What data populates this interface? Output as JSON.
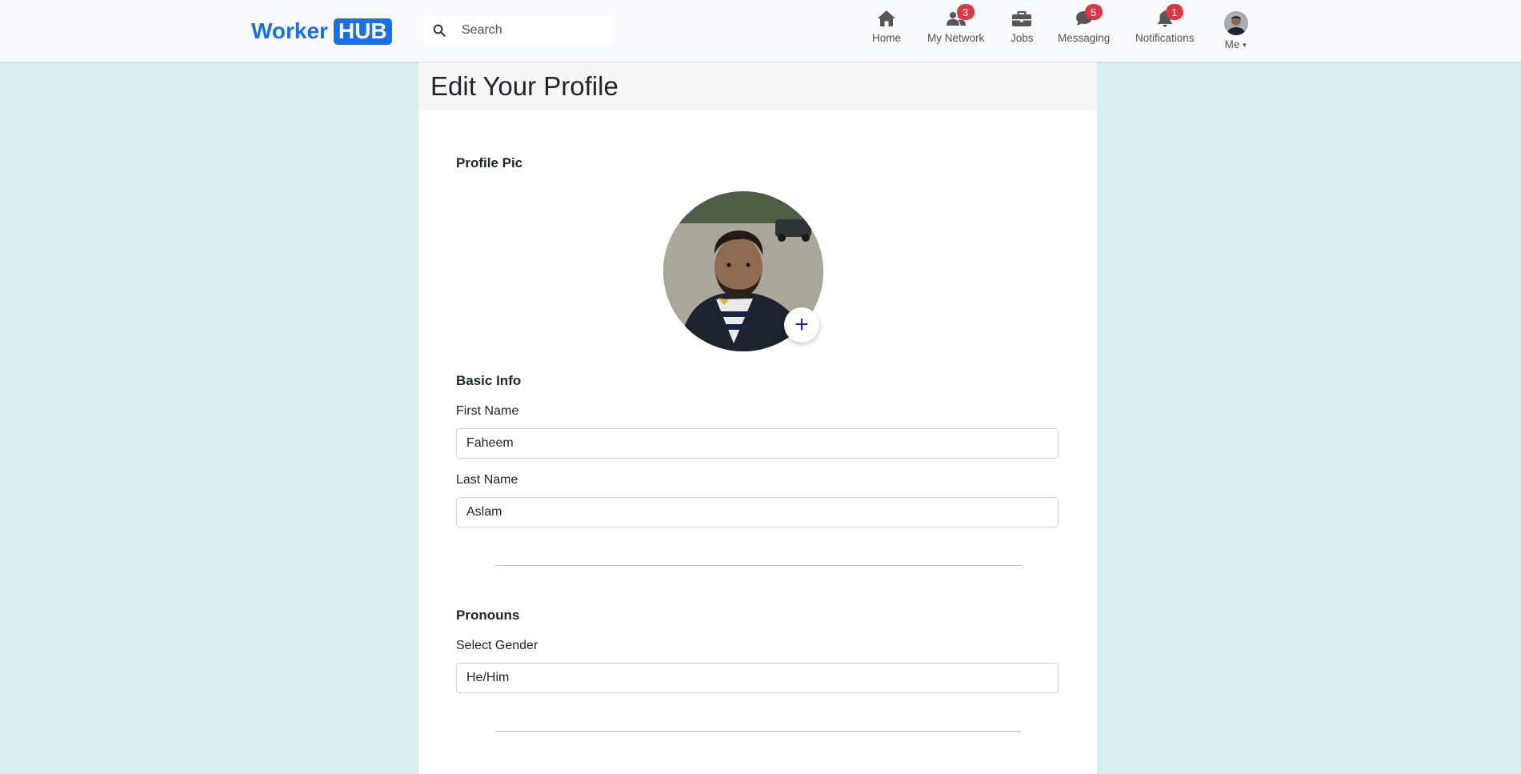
{
  "brand": {
    "name": "Worker",
    "badge": "HUB",
    "color": "#1a6ee8"
  },
  "search": {
    "placeholder": "Search"
  },
  "nav": {
    "home": {
      "label": "Home",
      "icon": "home-icon"
    },
    "network": {
      "label": "My Network",
      "badge": "3",
      "icon": "people-icon"
    },
    "jobs": {
      "label": "Jobs",
      "icon": "briefcase-icon"
    },
    "messaging": {
      "label": "Messaging",
      "badge": "5",
      "icon": "chat-icon"
    },
    "notifications": {
      "label": "Notifications",
      "badge": "1",
      "icon": "bell-icon"
    },
    "me": {
      "label": "Me",
      "icon": "avatar"
    }
  },
  "page": {
    "title": "Edit Your Profile"
  },
  "profile_pic": {
    "section": "Profile Pic",
    "add_icon": "plus-icon"
  },
  "basic_info": {
    "section": "Basic Info",
    "first_name_label": "First Name",
    "first_name": "Faheem",
    "last_name_label": "Last Name",
    "last_name": "Aslam"
  },
  "pronouns": {
    "section": "Pronouns",
    "gender_label": "Select Gender",
    "gender": "He/Him"
  },
  "colors": {
    "badge": "#dc3545",
    "page_bg": "#daf0ee"
  }
}
